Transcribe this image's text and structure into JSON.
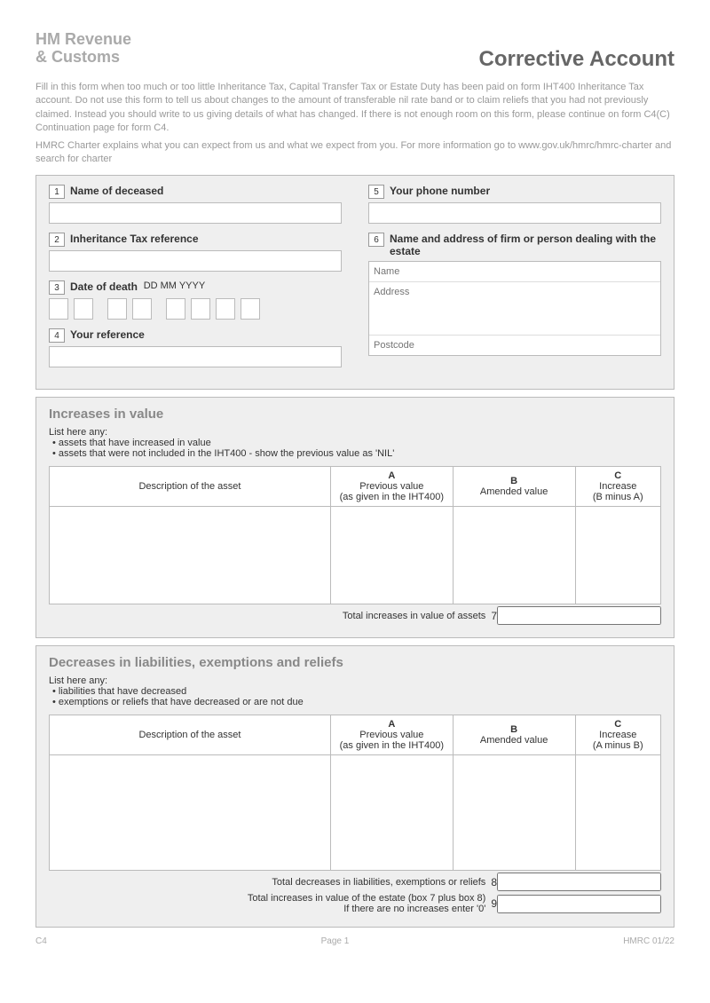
{
  "header": {
    "logo_line1": "HM Revenue",
    "logo_line2": "& Customs",
    "title": "Corrective Account"
  },
  "intro": {
    "p1": "Fill in this form when too much or too little Inheritance Tax, Capital Transfer Tax or Estate Duty has been paid on form IHT400 Inheritance Tax account. Do not use this form to tell us about changes to the amount of transferable nil rate band or to claim reliefs that you had not previously claimed. Instead you should write to us giving details of what has changed. If there is not enough room on this form, please continue on form C4(C) Continuation page for form C4.",
    "p2": "HMRC Charter explains what you can expect from us and what we expect from you. For more information go to www.gov.uk/hmrc/hmrc-charter and search for charter"
  },
  "fields": {
    "f1": {
      "num": "1",
      "label": "Name of deceased"
    },
    "f2": {
      "num": "2",
      "label": "Inheritance Tax reference"
    },
    "f3": {
      "num": "3",
      "label": "Date of death",
      "hint": "DD MM YYYY"
    },
    "f4": {
      "num": "4",
      "label": "Your reference"
    },
    "f5": {
      "num": "5",
      "label": "Your phone number"
    },
    "f6": {
      "num": "6",
      "label": "Name and address of firm or person dealing with the estate",
      "name_ph": "Name",
      "addr_ph": "Address",
      "postcode_ph": "Postcode"
    }
  },
  "increases": {
    "title": "Increases in value",
    "list_label": "List here any:",
    "b1": "• assets that have increased in value",
    "b2": "• assets that were not included in the IHT400 - show the previous value as 'NIL'",
    "col_desc": "Description of the asset",
    "col_a": "A",
    "col_a_sub": "Previous value",
    "col_a_sub2": "(as given in the IHT400)",
    "col_b": "B",
    "col_b_sub": "Amended value",
    "col_c": "C",
    "col_c_sub": "Increase",
    "col_c_sub2": "(B minus A)",
    "total_label": "Total increases in value of assets",
    "total_num": "7"
  },
  "decreases": {
    "title": "Decreases in liabilities, exemptions and reliefs",
    "list_label": "List here any:",
    "b1": "•  liabilities that have decreased",
    "b2": "•  exemptions or reliefs that have decreased or are not due",
    "col_desc": "Description of the asset",
    "col_a": "A",
    "col_a_sub": "Previous value",
    "col_a_sub2": "(as given in the IHT400)",
    "col_b": "B",
    "col_b_sub": "Amended value",
    "col_c": "C",
    "col_c_sub": "Increase",
    "col_c_sub2": "(A minus B)",
    "total_label": "Total decreases in liabilities, exemptions or reliefs",
    "total_num": "8",
    "grand_label": "Total increases in value of the estate (box 7 plus box 8)",
    "grand_sub": "If there are no increases enter '0'",
    "grand_num": "9"
  },
  "footer": {
    "left": "C4",
    "center": "Page 1",
    "right": "HMRC 01/22"
  }
}
